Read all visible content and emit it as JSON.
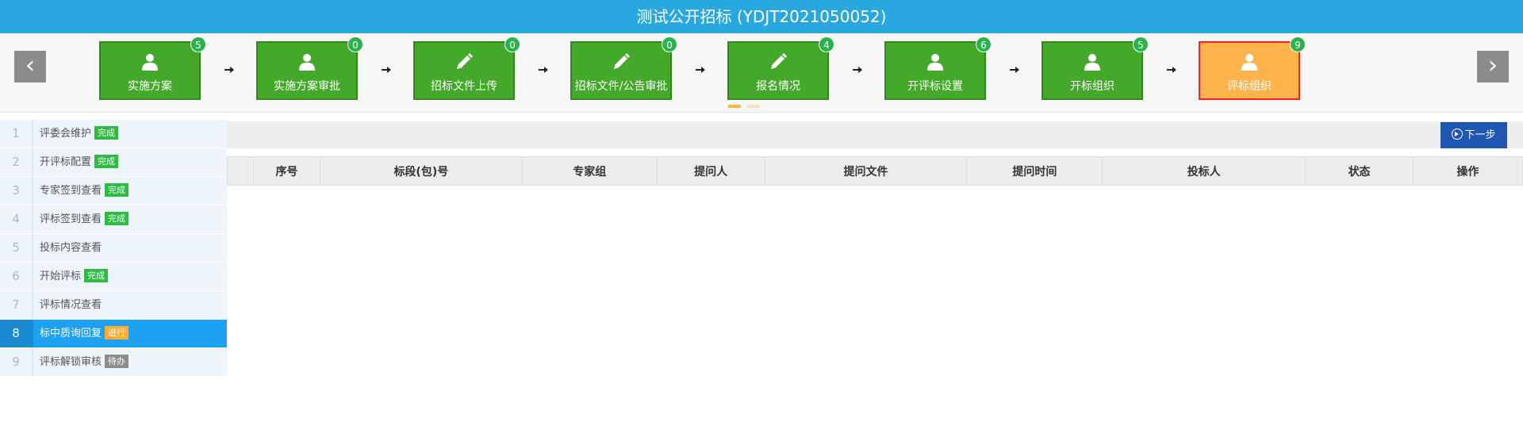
{
  "header": {
    "title": "测试公开招标 (YDJT2021050052)"
  },
  "flow": {
    "prev_label": "‹",
    "next_label": "›",
    "steps": [
      {
        "label": "实施方案",
        "badge": "5",
        "icon": "user-icon",
        "active": false
      },
      {
        "label": "实施方案审批",
        "badge": "0",
        "icon": "user-icon",
        "active": false
      },
      {
        "label": "招标文件上传",
        "badge": "0",
        "icon": "pencil-icon",
        "active": false
      },
      {
        "label": "招标文件/公告审批",
        "badge": "0",
        "icon": "pencil-icon",
        "active": false
      },
      {
        "label": "报名情况",
        "badge": "4",
        "icon": "pencil-icon",
        "active": false
      },
      {
        "label": "开评标设置",
        "badge": "6",
        "icon": "user-icon",
        "active": false
      },
      {
        "label": "开标组织",
        "badge": "5",
        "icon": "user-icon",
        "active": false
      },
      {
        "label": "评标组织",
        "badge": "9",
        "icon": "user-icon",
        "active": true
      }
    ],
    "page_dots": 2,
    "current_page": 1
  },
  "sidebar": {
    "items": [
      {
        "num": "1",
        "label": "评委会维护",
        "status": "完成",
        "status_kind": "done"
      },
      {
        "num": "2",
        "label": "开评标配置",
        "status": "完成",
        "status_kind": "done"
      },
      {
        "num": "3",
        "label": "专家签到查看",
        "status": "完成",
        "status_kind": "done"
      },
      {
        "num": "4",
        "label": "评标签到查看",
        "status": "完成",
        "status_kind": "done"
      },
      {
        "num": "5",
        "label": "投标内容查看",
        "status": "",
        "status_kind": ""
      },
      {
        "num": "6",
        "label": "开始评标",
        "status": "完成",
        "status_kind": "done"
      },
      {
        "num": "7",
        "label": "评标情况查看",
        "status": "",
        "status_kind": ""
      },
      {
        "num": "8",
        "label": "标中质询回复",
        "status": "进行",
        "status_kind": "doing",
        "active": true
      },
      {
        "num": "9",
        "label": "评标解锁审核",
        "status": "待办",
        "status_kind": "todo"
      }
    ]
  },
  "toolbar": {
    "next_step_label": "下一步"
  },
  "table": {
    "columns": [
      "",
      "序号",
      "标段(包)号",
      "专家组",
      "提问人",
      "提问文件",
      "提问时间",
      "投标人",
      "状态",
      "操作"
    ],
    "rows": []
  },
  "colors": {
    "title_bar": "#29a8e0",
    "step_green": "#44a82a",
    "step_active": "#ffb34a",
    "badge_green": "#2bb24c",
    "sidebar_active": "#1da1f2",
    "next_step_button": "#1f56b1"
  }
}
